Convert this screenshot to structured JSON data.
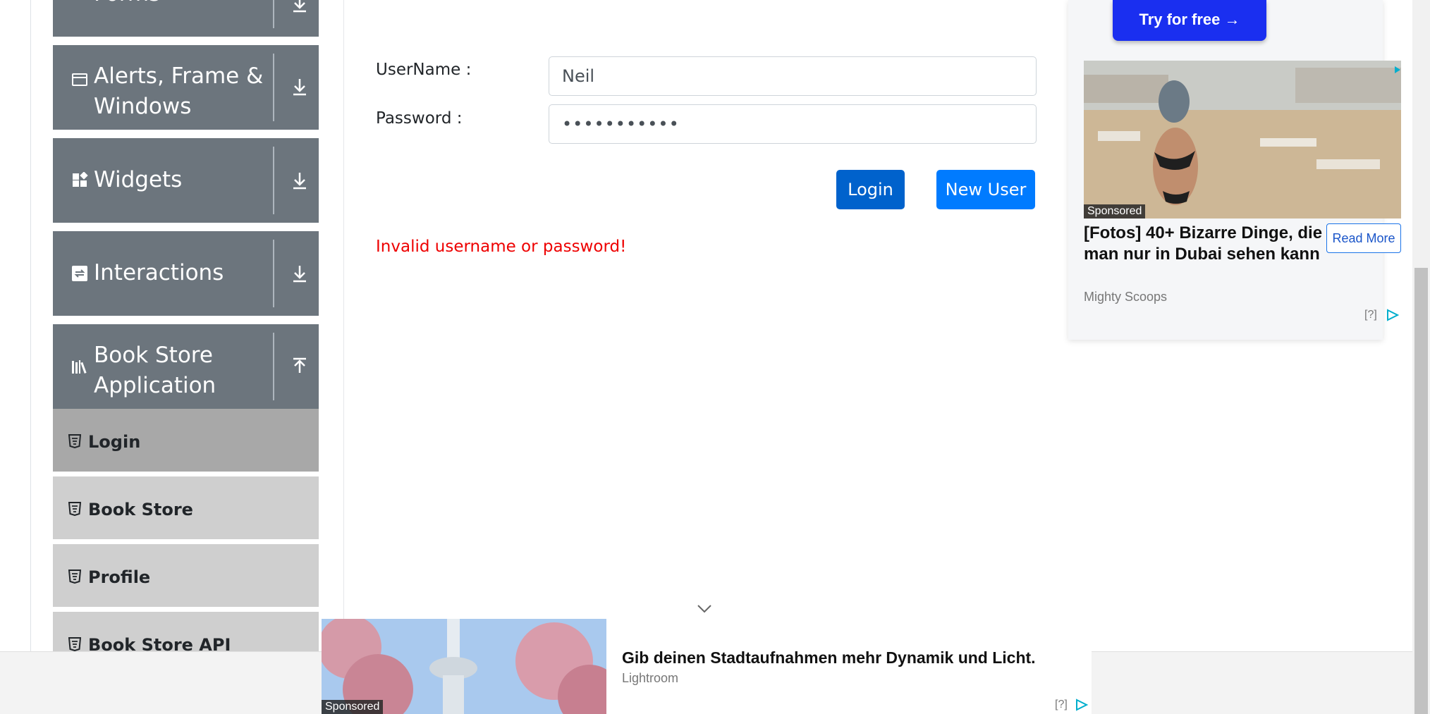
{
  "sidebar": {
    "groups": [
      {
        "title": "Forms",
        "icon": "form-icon",
        "expanded": false
      },
      {
        "title": "Alerts, Frame & Windows",
        "icon": "window-icon",
        "expanded": false
      },
      {
        "title": "Widgets",
        "icon": "widgets-icon",
        "expanded": false
      },
      {
        "title": "Interactions",
        "icon": "interactions-icon",
        "expanded": false
      },
      {
        "title": "Book Store Application",
        "icon": "books-icon",
        "expanded": true
      }
    ],
    "book_store_items": [
      {
        "label": "Login",
        "active": true
      },
      {
        "label": "Book Store",
        "active": false
      },
      {
        "label": "Profile",
        "active": false
      },
      {
        "label": "Book Store API",
        "active": false
      }
    ]
  },
  "login_form": {
    "username_label": "UserName :",
    "username_value": "Neil",
    "password_label": "Password :",
    "password_value": "•••••••••••",
    "login_button": "Login",
    "new_user_button": "New User",
    "error_message": "Invalid username or password!"
  },
  "right_ad": {
    "cta": "Try for free →",
    "sponsored": "Sponsored",
    "headline": "[Fotos] 40+ Bizarre Dinge, die man nur in Dubai sehen kann",
    "source": "Mighty Scoops",
    "read_more": "Read More",
    "help": "[?]"
  },
  "bottom_ad": {
    "sponsored": "Sponsored",
    "headline": "Gib deinen Stadtaufnahmen mehr Dynamik und Licht.",
    "source": "Lightroom",
    "help": "[?]"
  },
  "colors": {
    "group_bg": "#6c757d",
    "sub_bg": "#cfcfcf",
    "sub_active_bg": "#a8a8a8",
    "login_btn": "#0062cc",
    "new_user_btn": "#007bff",
    "error": "#ee0000"
  }
}
